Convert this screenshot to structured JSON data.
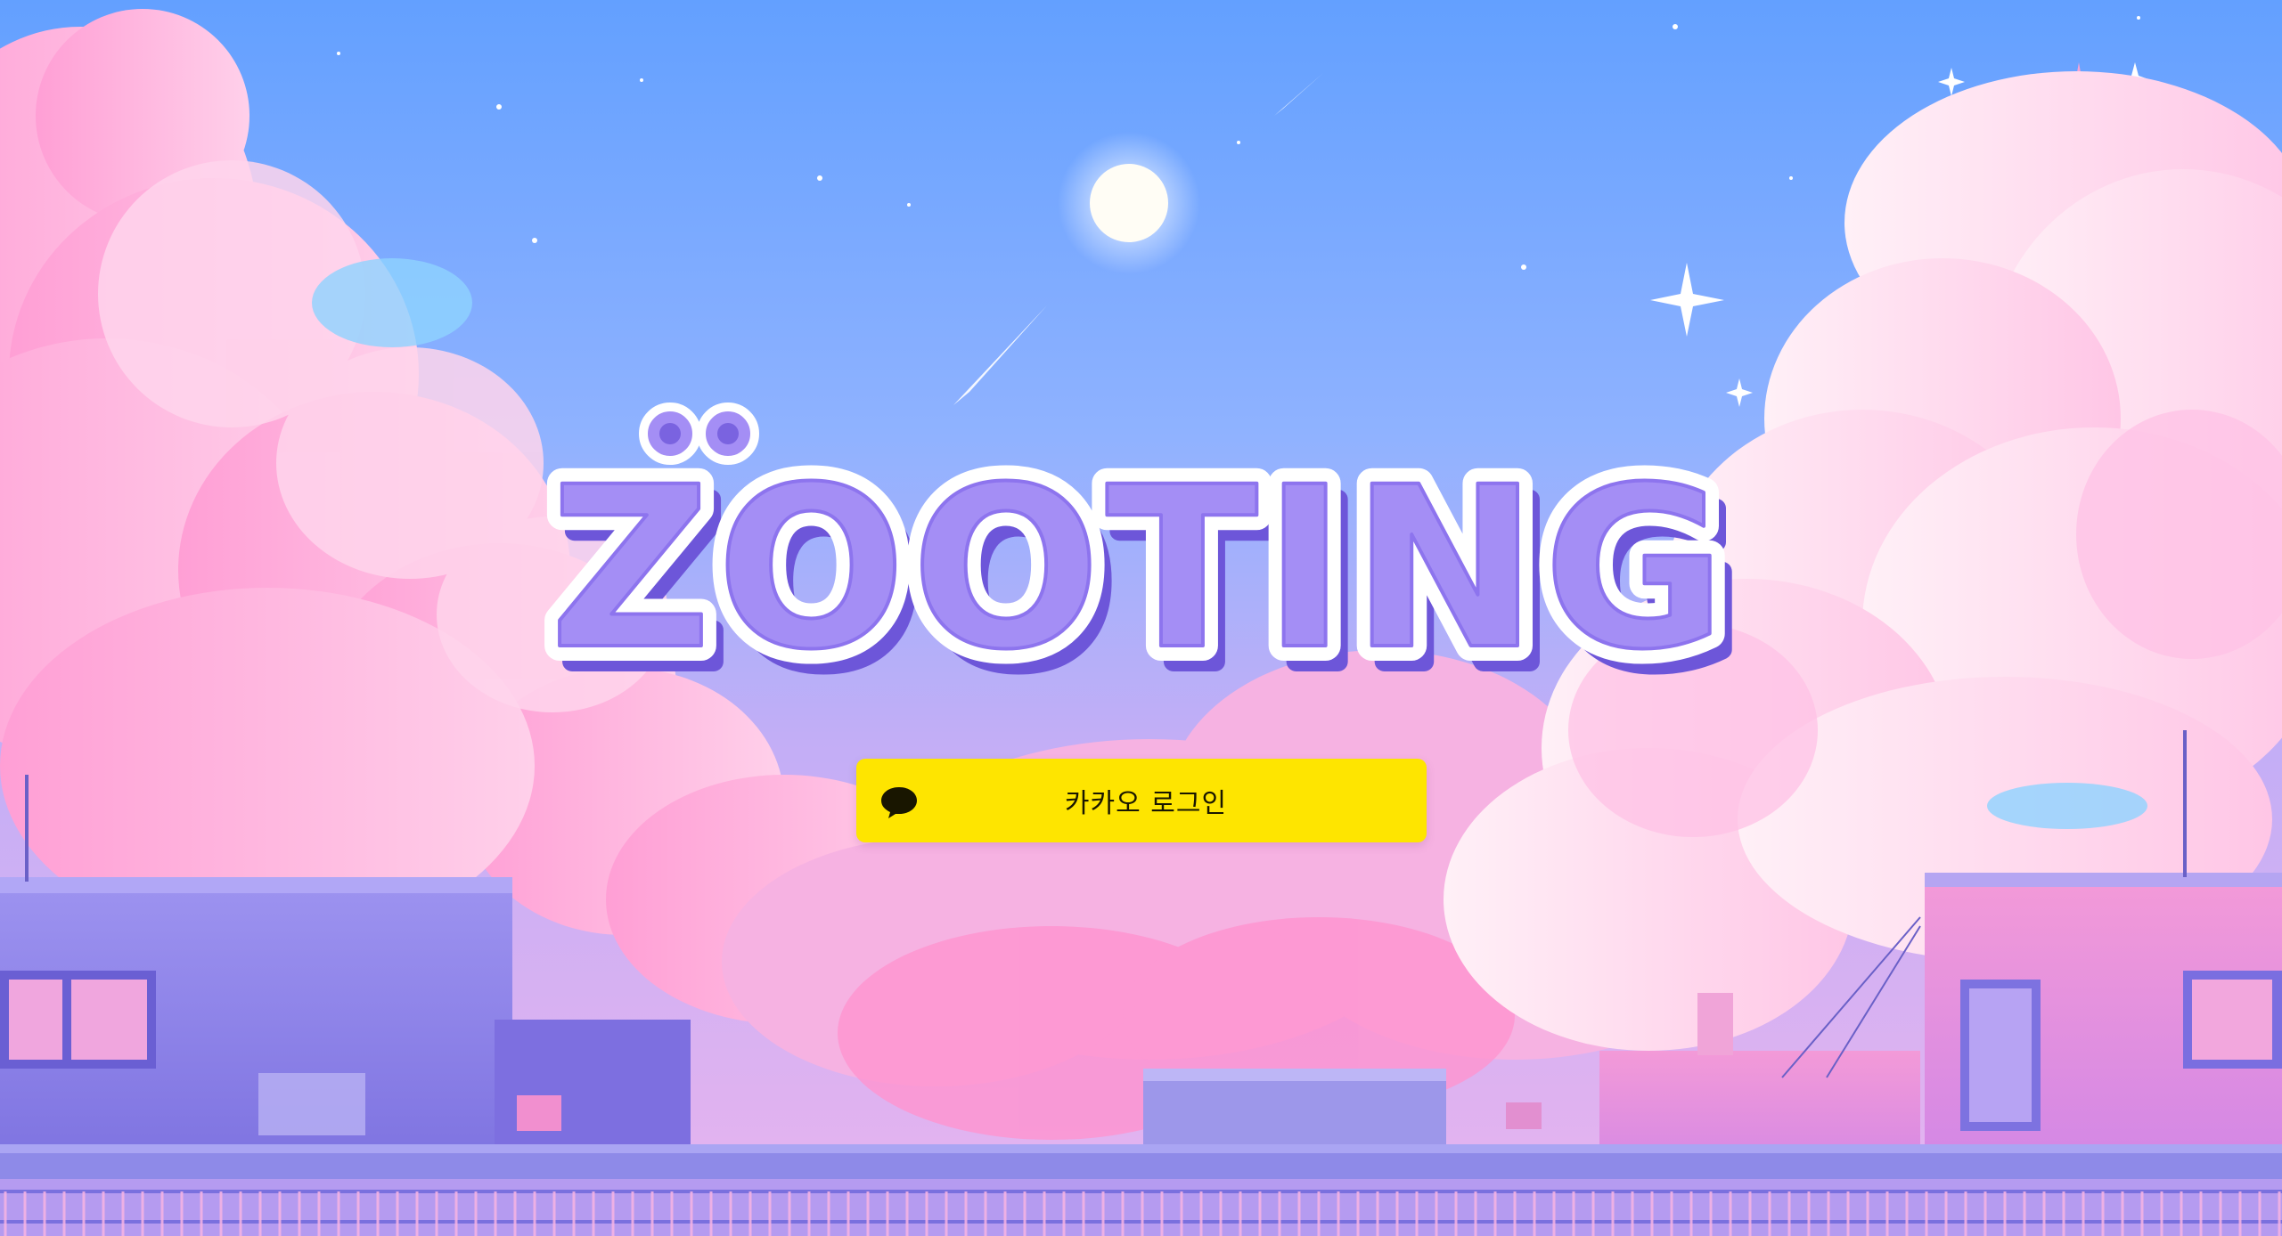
{
  "page": {
    "title": "ZOOTING"
  },
  "logo": {
    "text": "ZOOTING",
    "fill_color": "#a48ef5",
    "shadow_color": "#6d56d9",
    "outline_color": "#ffffff"
  },
  "login": {
    "kakao_label": "카카오 로그인",
    "button_color": "#fee500",
    "text_color": "#191600",
    "icon": "speech-bubble-icon"
  },
  "background": {
    "sky_top": "#6aa2ff",
    "sky_bottom": "#c9a9f5",
    "cloud_pink": "#ffb8e1",
    "building_purple": "#8c86e6"
  }
}
